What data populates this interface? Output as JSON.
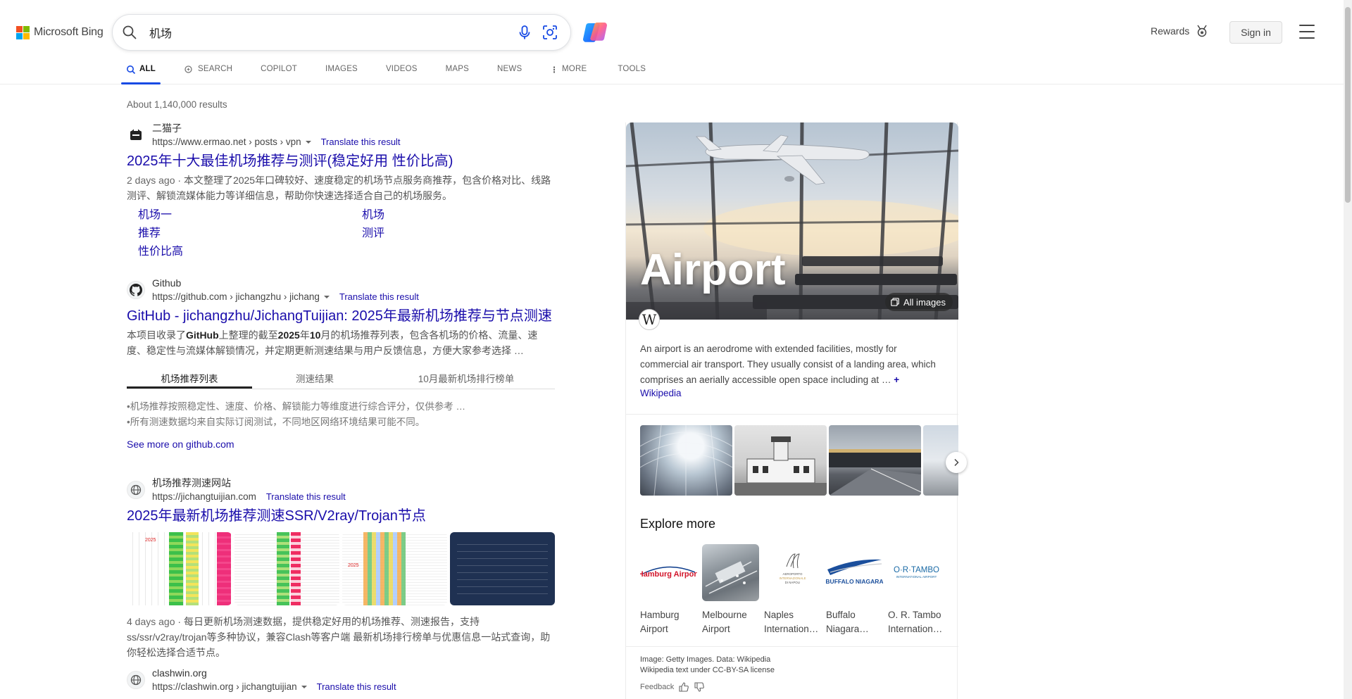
{
  "header": {
    "brand": "Microsoft Bing",
    "search_value": "机场",
    "rewards_label": "Rewards",
    "signin_label": "Sign in"
  },
  "nav": {
    "tabs": [
      {
        "label": "ALL",
        "active": true
      },
      {
        "label": "SEARCH"
      },
      {
        "label": "COPILOT"
      },
      {
        "label": "IMAGES"
      },
      {
        "label": "VIDEOS"
      },
      {
        "label": "MAPS"
      },
      {
        "label": "NEWS"
      },
      {
        "label": "MORE"
      },
      {
        "label": "TOOLS"
      }
    ]
  },
  "results_count": "About 1,140,000 results",
  "results": [
    {
      "site_name": "二猫子",
      "url": "https://www.ermao.net › posts › vpn",
      "translate": "Translate this result",
      "title": "2025年十大最佳机场推荐与测评(稳定好用 性价比高)",
      "date": "2 days ago",
      "snippet": "本文整理了2025年口碑较好、速度稳定的机场节点服务商推荐，包含价格对比、线路测评、解锁流媒体能力等详细信息，帮助你快速选择适合自己的机场服务。",
      "sublinks": [
        "机场一",
        "机场",
        "推荐",
        "测评",
        "性价比高"
      ]
    },
    {
      "site_name": "Github",
      "url": "https://github.com › jichangzhu › jichang",
      "translate": "Translate this result",
      "title": "GitHub - jichangzhu/JichangTuijian: 2025年最新机场推荐与节点测速 …",
      "snippet_pre": "本项目收录了",
      "snippet_b1": "GitHub",
      "snippet_mid": "上整理的截至",
      "snippet_b2": "2025",
      "snippet_mid2": "年",
      "snippet_b3": "10",
      "snippet_post": "月的机场推荐列表，包含各机场的价格、流量、速度、稳定性与流媒体解锁情况，并定期更新测速结果与用户反馈信息，方便大家参考选择 …",
      "deep_tabs": [
        "机场推荐列表",
        "测速结果",
        "10月最新机场排行榜单"
      ],
      "bullets": [
        "•机场推荐按照稳定性、速度、价格、解锁能力等维度进行综合评分，仅供参考 …",
        "•所有测速数据均来自实际订阅测试，不同地区网络环境结果可能不同。"
      ],
      "see_more": "See more on github.com"
    },
    {
      "site_name": "机场推荐测速网站",
      "url": "https://jichangtuijian.com",
      "translate": "Translate this result",
      "title": "2025年最新机场推荐测速SSR/V2ray/Trojan节点",
      "date": "4 days ago",
      "snippet": "每日更新机场测速数据，提供稳定好用的机场推荐、测速报告，支持ss/ssr/v2ray/trojan等多种协议，兼容Clash等客户端 最新机场排行榜单与优惠信息一站式查询，助你轻松选择合适节点。",
      "thumb_label": "2025"
    },
    {
      "site_name": "clashwin.org",
      "url": "https://clashwin.org › jichangtuijian",
      "translate": "Translate this result"
    }
  ],
  "knowledge_panel": {
    "title": "Airport",
    "all_images": "All images",
    "description": "An airport is an aerodrome with extended facilities, mostly for commercial air transport. They usually consist of a landing area, which comprises an aerially accessible open space including at …",
    "more": "+",
    "source": "Wikipedia",
    "explore_title": "Explore more",
    "related": [
      {
        "name": "Hamburg Airport",
        "logo_text": "Hamburg Airport"
      },
      {
        "name": "Melbourne Airport"
      },
      {
        "name": "Naples Internation…",
        "logo_text": "AEROPORTO INTERNAZIONALE DI NAPOLI"
      },
      {
        "name": "Buffalo Niagara…",
        "logo_text": "BUFFALO NIAGARA"
      },
      {
        "name": "O. R. Tambo Internation…",
        "logo_text": "O·R·TAMBO INTERNATIONAL AIRPORT"
      }
    ],
    "credit_line1": "Image: Getty Images. Data: Wikipedia",
    "credit_line2": "Wikipedia text under CC-BY-SA license",
    "feedback": "Feedback"
  },
  "colors": {
    "link": "#1a0dab",
    "accent": "#174ae4",
    "ms_red": "#f25022",
    "ms_green": "#7fba00",
    "ms_blue": "#00a4ef",
    "ms_yellow": "#ffb900"
  }
}
